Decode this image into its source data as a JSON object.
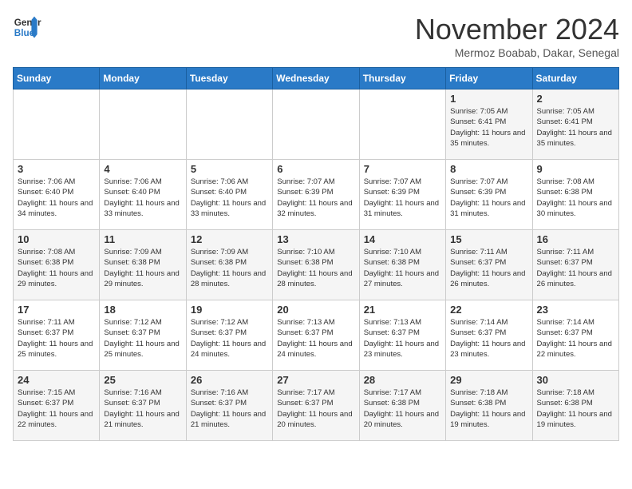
{
  "header": {
    "logo_line1": "General",
    "logo_line2": "Blue",
    "month": "November 2024",
    "location": "Mermoz Boabab, Dakar, Senegal"
  },
  "days_of_week": [
    "Sunday",
    "Monday",
    "Tuesday",
    "Wednesday",
    "Thursday",
    "Friday",
    "Saturday"
  ],
  "weeks": [
    [
      {
        "day": "",
        "info": ""
      },
      {
        "day": "",
        "info": ""
      },
      {
        "day": "",
        "info": ""
      },
      {
        "day": "",
        "info": ""
      },
      {
        "day": "",
        "info": ""
      },
      {
        "day": "1",
        "info": "Sunrise: 7:05 AM\nSunset: 6:41 PM\nDaylight: 11 hours and 35 minutes."
      },
      {
        "day": "2",
        "info": "Sunrise: 7:05 AM\nSunset: 6:41 PM\nDaylight: 11 hours and 35 minutes."
      }
    ],
    [
      {
        "day": "3",
        "info": "Sunrise: 7:06 AM\nSunset: 6:40 PM\nDaylight: 11 hours and 34 minutes."
      },
      {
        "day": "4",
        "info": "Sunrise: 7:06 AM\nSunset: 6:40 PM\nDaylight: 11 hours and 33 minutes."
      },
      {
        "day": "5",
        "info": "Sunrise: 7:06 AM\nSunset: 6:40 PM\nDaylight: 11 hours and 33 minutes."
      },
      {
        "day": "6",
        "info": "Sunrise: 7:07 AM\nSunset: 6:39 PM\nDaylight: 11 hours and 32 minutes."
      },
      {
        "day": "7",
        "info": "Sunrise: 7:07 AM\nSunset: 6:39 PM\nDaylight: 11 hours and 31 minutes."
      },
      {
        "day": "8",
        "info": "Sunrise: 7:07 AM\nSunset: 6:39 PM\nDaylight: 11 hours and 31 minutes."
      },
      {
        "day": "9",
        "info": "Sunrise: 7:08 AM\nSunset: 6:38 PM\nDaylight: 11 hours and 30 minutes."
      }
    ],
    [
      {
        "day": "10",
        "info": "Sunrise: 7:08 AM\nSunset: 6:38 PM\nDaylight: 11 hours and 29 minutes."
      },
      {
        "day": "11",
        "info": "Sunrise: 7:09 AM\nSunset: 6:38 PM\nDaylight: 11 hours and 29 minutes."
      },
      {
        "day": "12",
        "info": "Sunrise: 7:09 AM\nSunset: 6:38 PM\nDaylight: 11 hours and 28 minutes."
      },
      {
        "day": "13",
        "info": "Sunrise: 7:10 AM\nSunset: 6:38 PM\nDaylight: 11 hours and 28 minutes."
      },
      {
        "day": "14",
        "info": "Sunrise: 7:10 AM\nSunset: 6:38 PM\nDaylight: 11 hours and 27 minutes."
      },
      {
        "day": "15",
        "info": "Sunrise: 7:11 AM\nSunset: 6:37 PM\nDaylight: 11 hours and 26 minutes."
      },
      {
        "day": "16",
        "info": "Sunrise: 7:11 AM\nSunset: 6:37 PM\nDaylight: 11 hours and 26 minutes."
      }
    ],
    [
      {
        "day": "17",
        "info": "Sunrise: 7:11 AM\nSunset: 6:37 PM\nDaylight: 11 hours and 25 minutes."
      },
      {
        "day": "18",
        "info": "Sunrise: 7:12 AM\nSunset: 6:37 PM\nDaylight: 11 hours and 25 minutes."
      },
      {
        "day": "19",
        "info": "Sunrise: 7:12 AM\nSunset: 6:37 PM\nDaylight: 11 hours and 24 minutes."
      },
      {
        "day": "20",
        "info": "Sunrise: 7:13 AM\nSunset: 6:37 PM\nDaylight: 11 hours and 24 minutes."
      },
      {
        "day": "21",
        "info": "Sunrise: 7:13 AM\nSunset: 6:37 PM\nDaylight: 11 hours and 23 minutes."
      },
      {
        "day": "22",
        "info": "Sunrise: 7:14 AM\nSunset: 6:37 PM\nDaylight: 11 hours and 23 minutes."
      },
      {
        "day": "23",
        "info": "Sunrise: 7:14 AM\nSunset: 6:37 PM\nDaylight: 11 hours and 22 minutes."
      }
    ],
    [
      {
        "day": "24",
        "info": "Sunrise: 7:15 AM\nSunset: 6:37 PM\nDaylight: 11 hours and 22 minutes."
      },
      {
        "day": "25",
        "info": "Sunrise: 7:16 AM\nSunset: 6:37 PM\nDaylight: 11 hours and 21 minutes."
      },
      {
        "day": "26",
        "info": "Sunrise: 7:16 AM\nSunset: 6:37 PM\nDaylight: 11 hours and 21 minutes."
      },
      {
        "day": "27",
        "info": "Sunrise: 7:17 AM\nSunset: 6:37 PM\nDaylight: 11 hours and 20 minutes."
      },
      {
        "day": "28",
        "info": "Sunrise: 7:17 AM\nSunset: 6:38 PM\nDaylight: 11 hours and 20 minutes."
      },
      {
        "day": "29",
        "info": "Sunrise: 7:18 AM\nSunset: 6:38 PM\nDaylight: 11 hours and 19 minutes."
      },
      {
        "day": "30",
        "info": "Sunrise: 7:18 AM\nSunset: 6:38 PM\nDaylight: 11 hours and 19 minutes."
      }
    ]
  ]
}
